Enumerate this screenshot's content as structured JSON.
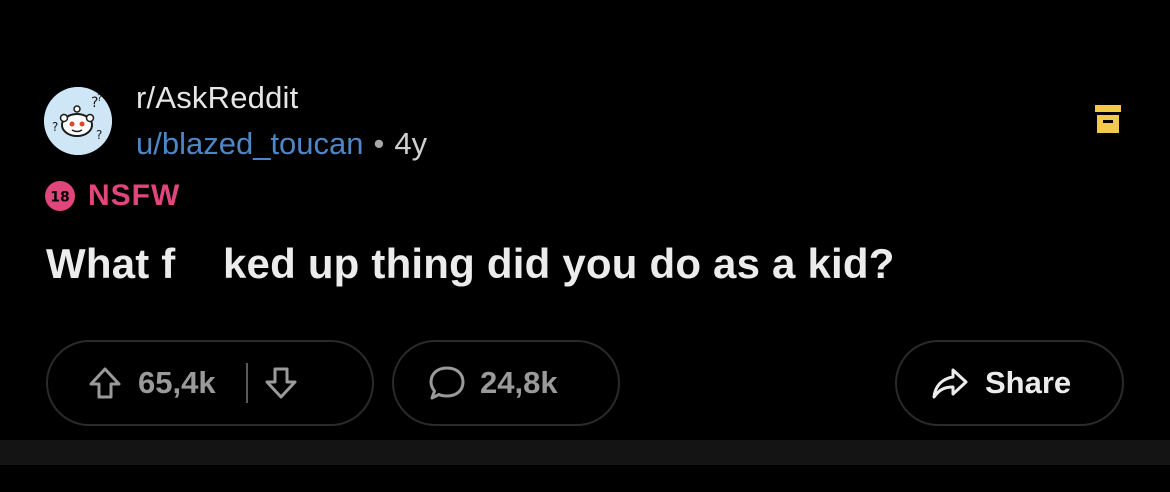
{
  "post": {
    "subreddit": "r/AskReddit",
    "username": "u/blazed_toucan",
    "separator": "•",
    "age": "4y",
    "nsfw_badge": "18",
    "nsfw_label": "NSFW",
    "title": "What f    ked up thing did you do as a kid?"
  },
  "actions": {
    "upvote_count": "65,4k",
    "comment_count": "24,8k",
    "share_label": "Share"
  },
  "icons": {
    "avatar": "snoo-avatar-icon",
    "save": "archive-icon",
    "upvote": "arrow-up-icon",
    "downvote": "arrow-down-icon",
    "comment": "speech-bubble-icon",
    "share": "share-arrow-icon"
  },
  "colors": {
    "background": "#000000",
    "username": "#4f86c6",
    "nsfw": "#e0467c",
    "save_icon": "#f2c94c",
    "pill_border": "#2a2a2a",
    "muted_text": "#9a9a9a"
  }
}
